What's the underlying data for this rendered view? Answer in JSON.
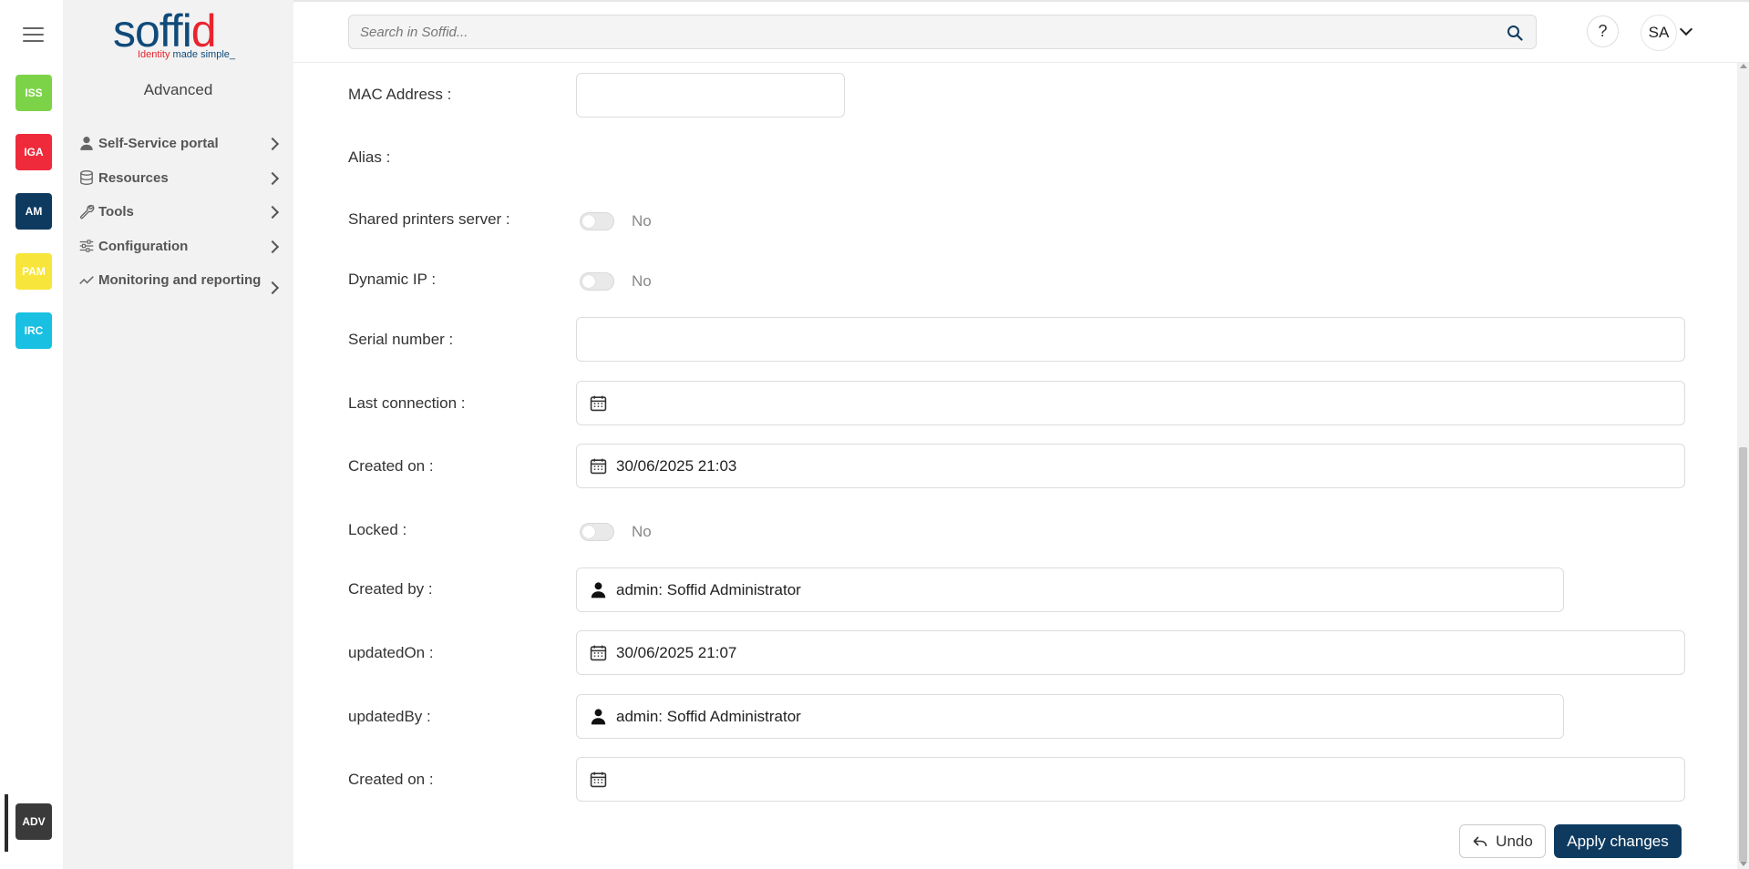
{
  "rail": {
    "apps": [
      {
        "label": "ISS",
        "color": "#7dd347"
      },
      {
        "label": "IGA",
        "color": "#ee2a3b"
      },
      {
        "label": "AM",
        "color": "#0e3a5f"
      },
      {
        "label": "PAM",
        "color": "#f7e53b"
      },
      {
        "label": "IRC",
        "color": "#19c0e1"
      }
    ],
    "active_app": {
      "label": "ADV",
      "color": "#3a3a3a"
    }
  },
  "logo": {
    "word_main": "soffi",
    "word_accent": "d",
    "tag_red": "Identity ",
    "tag_dark": "made simple_"
  },
  "sidebar": {
    "title": "Advanced",
    "items": [
      {
        "label": "Self-Service portal",
        "icon": "user-icon"
      },
      {
        "label": "Resources",
        "icon": "database-icon"
      },
      {
        "label": "Tools",
        "icon": "wrench-icon"
      },
      {
        "label": "Configuration",
        "icon": "sliders-icon"
      },
      {
        "label": "Monitoring and reporting",
        "icon": "chart-line-icon"
      }
    ]
  },
  "header": {
    "search_placeholder": "Search in Soffid...",
    "help_label": "?",
    "avatar_initials": "SA"
  },
  "form": {
    "mac_address": {
      "label": "MAC Address :",
      "value": ""
    },
    "alias": {
      "label": "Alias :"
    },
    "shared_printers": {
      "label": "Shared printers server :",
      "value": "No"
    },
    "dynamic_ip": {
      "label": "Dynamic IP :",
      "value": "No"
    },
    "serial_number": {
      "label": "Serial number :",
      "value": ""
    },
    "last_connection": {
      "label": "Last connection :",
      "value": ""
    },
    "created_on": {
      "label": "Created on :",
      "value": "30/06/2025 21:03"
    },
    "locked": {
      "label": "Locked :",
      "value": "No"
    },
    "created_by": {
      "label": "Created by :",
      "value": "admin: Soffid Administrator"
    },
    "updated_on": {
      "label": "updatedOn :",
      "value": "30/06/2025 21:07"
    },
    "updated_by": {
      "label": "updatedBy :",
      "value": "admin: Soffid Administrator"
    },
    "created_on_2": {
      "label": "Created on :",
      "value": ""
    }
  },
  "actions": {
    "undo_label": "Undo",
    "apply_label": "Apply changes"
  },
  "colors": {
    "brand": "#0e3a5f",
    "accent": "#e8242e"
  }
}
